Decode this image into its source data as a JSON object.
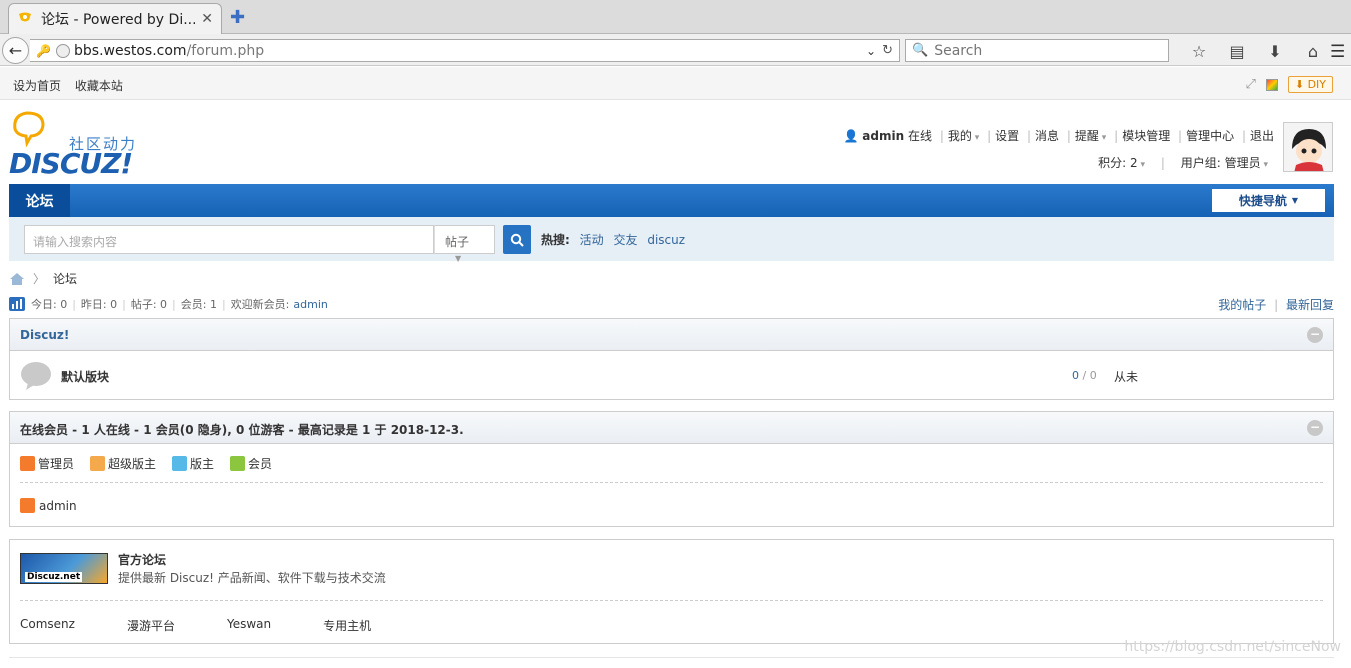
{
  "browser": {
    "tab_title": "论坛 - Powered by Di...",
    "tab_close": "✕",
    "new_tab": "✚",
    "url_host": "bbs.westos.com",
    "url_path": "/forum.php",
    "search_placeholder": "Search"
  },
  "bookmarks": {
    "set_home": "设为首页",
    "favorite": "收藏本站",
    "diy": "DIY"
  },
  "header": {
    "logo_tagline": "社区动力",
    "logo_brand": "DISCUZ!",
    "username": "admin",
    "online": "在线",
    "menu": [
      "我的",
      "设置",
      "消息",
      "提醒",
      "模块管理",
      "管理中心",
      "退出"
    ],
    "points": "积分: 2",
    "usergroup": "用户组: 管理员"
  },
  "nav": {
    "forum_tab": "论坛",
    "quick_nav": "快捷导航"
  },
  "search": {
    "placeholder": "请输入搜索内容",
    "type": "帖子",
    "hot_label": "热搜:",
    "hot_terms": [
      "活动",
      "交友",
      "discuz"
    ]
  },
  "breadcrumb": {
    "current": "论坛"
  },
  "stats": {
    "today": "今日: 0",
    "yesterday": "昨日: 0",
    "posts": "帖子: 0",
    "members": "会员: 1",
    "welcome": "欢迎新会员:",
    "newest": "admin",
    "my_posts": "我的帖子",
    "latest_reply": "最新回复"
  },
  "category": {
    "name": "Discuz!",
    "forum_name": "默认版块",
    "forum_threads": "0",
    "forum_sep": "/",
    "forum_posts": "0",
    "forum_last": "从未"
  },
  "online": {
    "title": "在线会员 - 1 人在线 - 1 会员(0 隐身), 0 位游客 - 最高记录是 1 于 2018-12-3.",
    "legend": [
      "管理员",
      "超级版主",
      "版主",
      "会员"
    ],
    "legend_colors": [
      "#f47a2c",
      "#f5a94d",
      "#57b9e8",
      "#8cc63f"
    ],
    "members": [
      "admin"
    ]
  },
  "links": {
    "banner_text": "Discuz.net",
    "title": "官方论坛",
    "desc": "提供最新 Discuz! 产品新闻、软件下载与技术交流",
    "friends": [
      "Comsenz",
      "漫游平台",
      "Yeswan",
      "专用主机"
    ]
  },
  "watermark": "https://blog.csdn.net/sinceNow"
}
